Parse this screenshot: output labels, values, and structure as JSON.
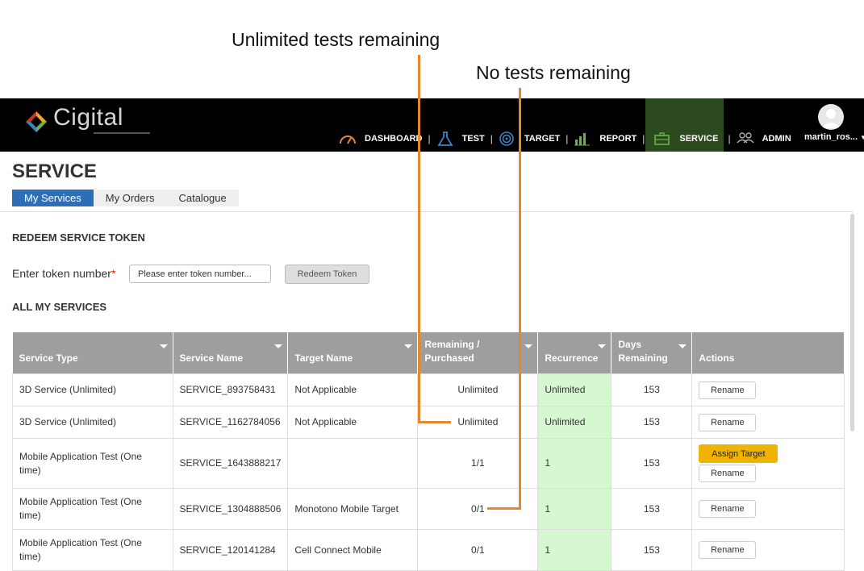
{
  "annotations": {
    "unlimited": "Unlimited tests remaining",
    "none": "No tests remaining"
  },
  "brand": {
    "logo_text": "Cigital"
  },
  "nav": {
    "items": [
      {
        "label": "DASHBOARD",
        "icon": "gauge-icon"
      },
      {
        "label": "TEST",
        "icon": "flask-icon"
      },
      {
        "label": "TARGET",
        "icon": "target-icon"
      },
      {
        "label": "REPORT",
        "icon": "bar-chart-icon"
      },
      {
        "label": "SERVICE",
        "icon": "briefcase-icon"
      },
      {
        "label": "ADMIN",
        "icon": "users-icon"
      }
    ],
    "user": "martin_ros..."
  },
  "page": {
    "title": "SERVICE",
    "tabs": [
      "My Services",
      "My Orders",
      "Catalogue"
    ],
    "active_tab": "My Services"
  },
  "redeem": {
    "title": "REDEEM SERVICE TOKEN",
    "label": "Enter token number",
    "required_mark": "*",
    "placeholder": "Please enter token number...",
    "button": "Redeem Token"
  },
  "services": {
    "title": "ALL MY SERVICES",
    "headers": {
      "type": "Service Type",
      "name": "Service Name",
      "target": "Target Name",
      "remaining_1": "Remaining /",
      "remaining_2": "Purchased",
      "recurrence": "Recurrence",
      "days_1": "Days",
      "days_2": "Remaining",
      "actions": "Actions"
    },
    "rows": [
      {
        "type": "3D Service (Unlimited)",
        "name": "SERVICE_893758431",
        "target": "Not Applicable",
        "remaining": "Unlimited",
        "recurrence": "Unlimited",
        "days": "153",
        "actions": [
          "Rename"
        ]
      },
      {
        "type": "3D Service (Unlimited)",
        "name": "SERVICE_1162784056",
        "target": "Not Applicable",
        "remaining": "Unlimited",
        "recurrence": "Unlimited",
        "days": "153",
        "actions": [
          "Rename"
        ]
      },
      {
        "type": "Mobile Application Test (One time)",
        "name": "SERVICE_1643888217",
        "target": "",
        "remaining": "1/1",
        "recurrence": "1",
        "days": "153",
        "actions": [
          "Assign Target",
          "Rename"
        ]
      },
      {
        "type": "Mobile Application Test (One time)",
        "name": "SERVICE_1304888506",
        "target": "Monotono Mobile Target",
        "remaining": "0/1",
        "recurrence": "1",
        "days": "153",
        "actions": [
          "Rename"
        ]
      },
      {
        "type": "Mobile Application Test (One time)",
        "name": "SERVICE_120141284",
        "target": "Cell Connect Mobile",
        "remaining": "0/1",
        "recurrence": "1",
        "days": "153",
        "actions": [
          "Rename"
        ]
      }
    ]
  },
  "colors": {
    "accent_tab": "#2f6eb5",
    "nav_active": "#2c4a1f",
    "annotation_line": "#e4872f",
    "recurrence_cell": "#d6f8d1",
    "assign_button": "#f0b400",
    "table_header": "#9e9e9e"
  }
}
